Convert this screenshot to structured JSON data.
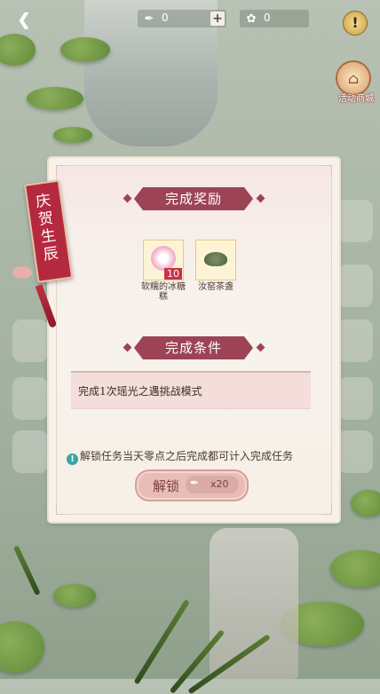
{
  "topbar": {
    "currency_a": {
      "value": "0",
      "plus": "+"
    },
    "currency_b": {
      "value": "0"
    },
    "alert": "!"
  },
  "shop": {
    "label": "活动商城"
  },
  "ribbon": {
    "text": "庆贺生辰"
  },
  "dialog": {
    "reward_title": "完成奖励",
    "rewards": [
      {
        "name": "软糯的冰糖糕",
        "count": "10"
      },
      {
        "name": "汝窑茶盏",
        "count": ""
      }
    ],
    "condition_title": "完成条件",
    "condition_text": "完成1次瑶光之遇挑战模式",
    "hint": "解锁任务当天零点之后完成都可计入完成任务",
    "unlock": {
      "label": "解锁",
      "cost": "x20"
    }
  },
  "colors": {
    "banner": "#9c4355",
    "ribbon": "#b5293e",
    "hint_icon": "#3ba2a3"
  },
  "icons": [
    "back-arrow-icon",
    "feather-icon",
    "flower-icon",
    "alert-icon",
    "shop-icon",
    "candy-icon",
    "teacup-icon",
    "info-icon"
  ]
}
